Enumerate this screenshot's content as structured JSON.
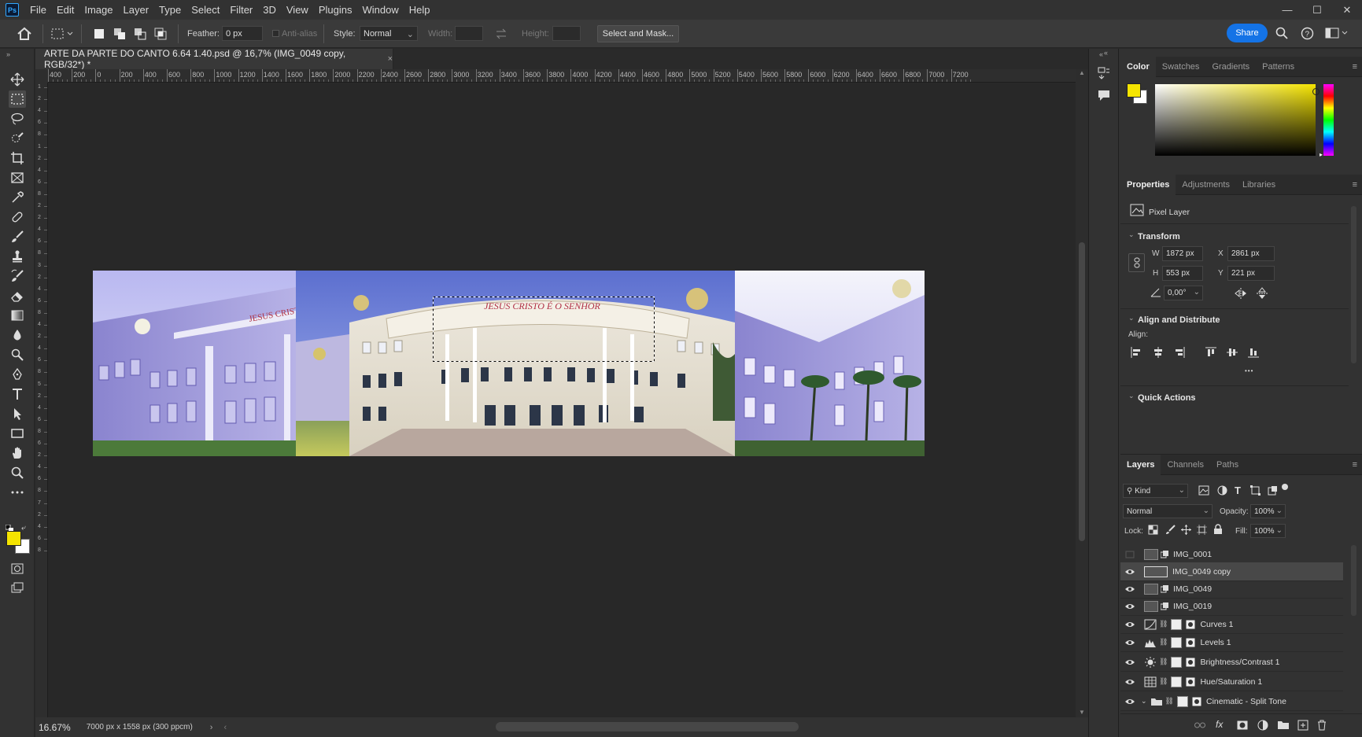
{
  "menu": {
    "logo": "Ps",
    "items": [
      "File",
      "Edit",
      "Image",
      "Layer",
      "Type",
      "Select",
      "Filter",
      "3D",
      "View",
      "Plugins",
      "Window",
      "Help"
    ]
  },
  "window_controls": [
    "—",
    "☐",
    "✕"
  ],
  "options": {
    "feather_label": "Feather:",
    "feather_value": "0 px",
    "antialias_label": "Anti-alias",
    "style_label": "Style:",
    "style_value": "Normal",
    "width_label": "Width:",
    "height_label": "Height:",
    "select_mask_label": "Select and Mask...",
    "share_label": "Share"
  },
  "document": {
    "tab_title": "ARTE DA PARTE DO CANTO  6.64   1.40.psd @ 16,7% (IMG_0049 copy, RGB/32*) *",
    "close": "×",
    "zoom": "16.67%",
    "doc_info": "7000 px x 1558 px (300 ppcm)",
    "sign_text": "JESUS CRISTO É O SENHOR",
    "sign_text_left": "JESUS CRISTO"
  },
  "ruler": {
    "top_ticks": [
      "400",
      "200",
      "0",
      "200",
      "400",
      "600",
      "800",
      "1000",
      "1200",
      "1400",
      "1600",
      "1800",
      "2000",
      "2200",
      "2400",
      "2600",
      "2800",
      "3000",
      "3200",
      "3400",
      "3600",
      "3800",
      "4000",
      "4200",
      "4400",
      "4600",
      "4800",
      "5000",
      "5200",
      "5400",
      "5600",
      "5800",
      "6000",
      "6200",
      "6400",
      "6600",
      "6800",
      "7000",
      "7200"
    ],
    "left_ticks": [
      "1",
      "2",
      "4",
      "6",
      "8",
      "1",
      "2",
      "4",
      "6",
      "8",
      "2",
      "2",
      "4",
      "6",
      "8",
      "3",
      "2",
      "4",
      "6",
      "8",
      "4",
      "2",
      "4",
      "6",
      "8",
      "5",
      "2",
      "4",
      "6",
      "8",
      "6",
      "2",
      "4",
      "6",
      "8",
      "7",
      "2",
      "4",
      "6",
      "8"
    ]
  },
  "color_panel": {
    "tabs": [
      "Color",
      "Swatches",
      "Gradients",
      "Patterns"
    ],
    "foreground": "#f5e400",
    "background": "#ffffff"
  },
  "properties": {
    "tabs": [
      "Properties",
      "Adjustments",
      "Libraries"
    ],
    "kind": "Pixel Layer",
    "transform_title": "Transform",
    "w_label": "W",
    "w_value": "1872 px",
    "x_label": "X",
    "x_value": "2861 px",
    "h_label": "H",
    "h_value": "553 px",
    "y_label": "Y",
    "y_value": "221 px",
    "angle_value": "0,00°",
    "align_title": "Align and Distribute",
    "align_label": "Align:",
    "quick_actions_title": "Quick Actions",
    "more": "•••"
  },
  "layers_panel": {
    "tabs": [
      "Layers",
      "Channels",
      "Paths"
    ],
    "filter_kind": "Kind",
    "blend_mode": "Normal",
    "opacity_label": "Opacity:",
    "opacity_value": "100%",
    "lock_label": "Lock:",
    "fill_label": "Fill:",
    "fill_value": "100%",
    "layers": [
      {
        "name": "IMG_0001",
        "visible": false,
        "selected": false,
        "type": "smart"
      },
      {
        "name": "IMG_0049 copy",
        "visible": true,
        "selected": true,
        "type": "smart"
      },
      {
        "name": "IMG_0049",
        "visible": true,
        "selected": false,
        "type": "smart"
      },
      {
        "name": "IMG_0019",
        "visible": true,
        "selected": false,
        "type": "smart"
      },
      {
        "name": "Curves 1",
        "visible": true,
        "selected": false,
        "type": "adjustment"
      },
      {
        "name": "Levels 1",
        "visible": true,
        "selected": false,
        "type": "adjustment"
      },
      {
        "name": "Brightness/Contrast 1",
        "visible": true,
        "selected": false,
        "type": "adjustment"
      },
      {
        "name": "Hue/Saturation 1",
        "visible": true,
        "selected": false,
        "type": "adjustment"
      },
      {
        "name": "Cinematic - Split Tone",
        "visible": true,
        "selected": false,
        "type": "group"
      }
    ]
  }
}
